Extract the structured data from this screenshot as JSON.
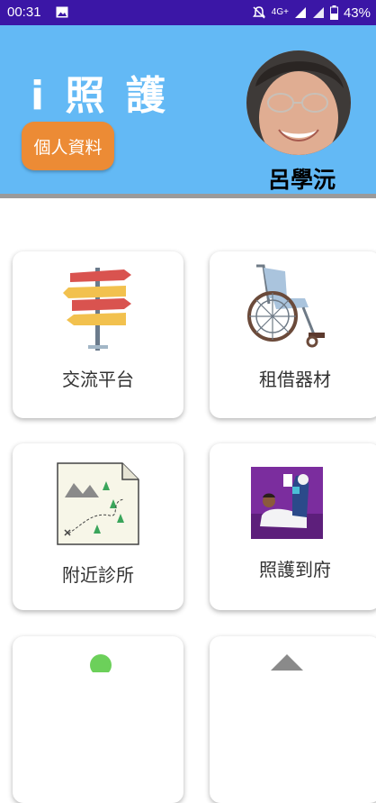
{
  "status_bar": {
    "time": "00:31",
    "network": "4G+",
    "battery": "43%"
  },
  "header": {
    "app_title": "i 照 護",
    "profile_button": "個人資料",
    "user_name": "呂學沅"
  },
  "menu": {
    "items": [
      {
        "label": "交流平台",
        "icon": "signpost-icon"
      },
      {
        "label": "租借器材",
        "icon": "wheelchair-icon"
      },
      {
        "label": "附近診所",
        "icon": "map-icon"
      },
      {
        "label": "照護到府",
        "icon": "home-care-icon"
      }
    ]
  },
  "colors": {
    "status_bar": "#3b16a6",
    "header": "#63b9f5",
    "profile_button": "#ec8b35"
  }
}
